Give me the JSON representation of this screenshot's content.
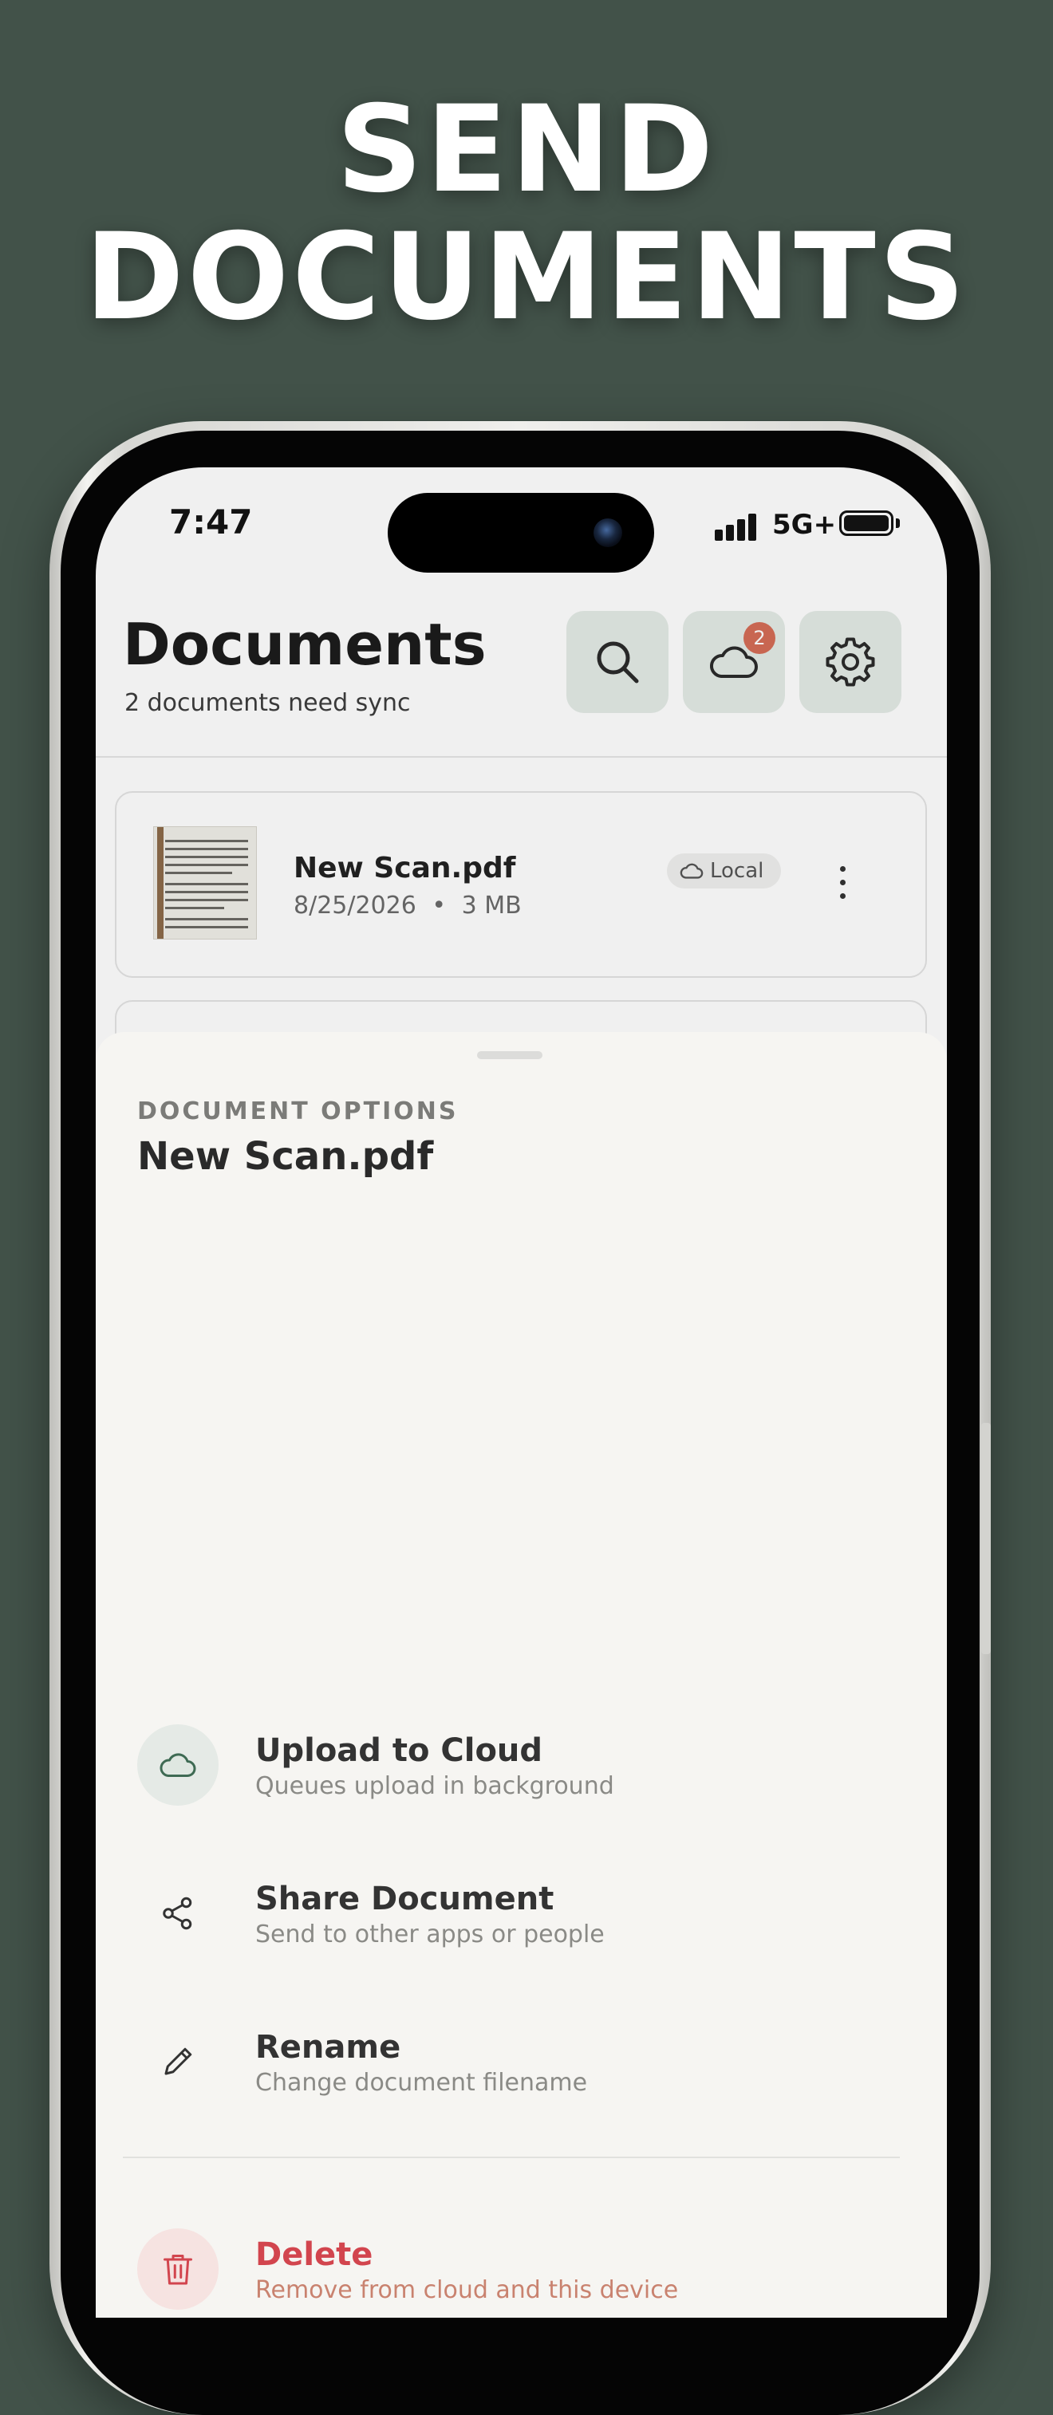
{
  "headline": {
    "line1": "SEND",
    "line2": "DOCUMENTS"
  },
  "status_bar": {
    "time": "7:47",
    "network": "5G+"
  },
  "header": {
    "title": "Documents",
    "subtitle": "2 documents need sync",
    "sync_badge_count": "2",
    "icons": [
      "search-icon",
      "cloud-icon",
      "gear-icon"
    ]
  },
  "documents": [
    {
      "name": "New Scan.pdf",
      "date": "8/25/2026",
      "separator": "•",
      "size": "3 MB",
      "status": "Local"
    }
  ],
  "sheet": {
    "eyebrow": "DOCUMENT OPTIONS",
    "title": "New Scan.pdf",
    "options": [
      {
        "label": "Upload to Cloud",
        "description": "Queues upload in background",
        "icon": "cloud-icon"
      },
      {
        "label": "Share Document",
        "description": "Send to other apps or people",
        "icon": "share-icon"
      },
      {
        "label": "Rename",
        "description": "Change document filename",
        "icon": "pencil-icon"
      },
      {
        "label": "Delete",
        "description": "Remove from cloud and this device",
        "icon": "trash-icon"
      }
    ]
  },
  "colors": {
    "background": "#425249",
    "accent_green": "#e4ebe6",
    "badge": "#d56d57",
    "delete_text": "#d2454e",
    "delete_desc": "#c9826f",
    "sheet_bg": "#f6f5f2"
  }
}
